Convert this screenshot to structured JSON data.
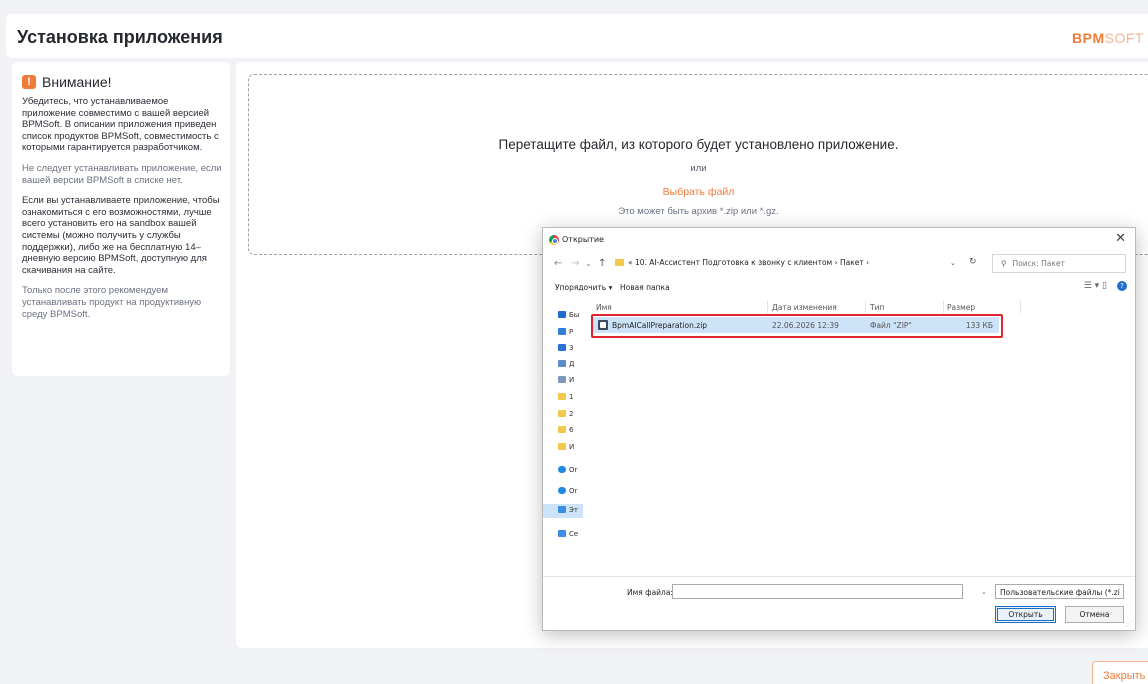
{
  "header": {
    "title": "Установка приложения",
    "logo_a": "BPM",
    "logo_b": "SOFT",
    "logo_accent": "#f07c3a"
  },
  "notice": {
    "icon": "warning-icon",
    "title": "Внимание!",
    "p1": "Убедитесь, что устанавливаемое приложение совместимо с вашей версией BPMSoft. В описании приложения приведен список продуктов BPMSoft, совместимость с которыми гарантируется разработчиком.",
    "p2": "Не следует устанавливать приложение, если вашей версии BPMSoft в списке нет.",
    "p3": "Если вы устанавливаете приложение, чтобы ознакомиться с его возможностями, лучше всего установить его на sandbox вашей системы (можно получить у службы поддержки), либо же на бесплатную 14–дневную версию BPMSoft, доступную для скачивания на сайте.",
    "p4": "Только после этого рекомендуем устанавливать продукт на продуктивную среду BPMSoft."
  },
  "dropzone": {
    "text": "Перетащите файл, из которого будет установлено приложение.",
    "or": "или",
    "choose": "Выбрать файл",
    "hint": "Это может быть архив *.zip или *.gz."
  },
  "close_label": "Закрыть",
  "dialog": {
    "title": "Открытие",
    "close_glyph": "✕",
    "back": "←",
    "forward": "→",
    "recent": "⌄",
    "up": "↑",
    "address": "« 10. AI-Ассистент Подготовка к звонку с клиентом › Пакет ›",
    "address_chevron": "⌄",
    "refresh": "↻",
    "search_icon": "⚲",
    "search_placeholder": "Поиск: Пакет",
    "organize": "Упорядочить ▾",
    "new_folder": "Новая папка",
    "view_icons": "☰ ▾ ▯",
    "help": "?",
    "nav": [
      {
        "label": "Бы",
        "color": "#1f6fd1"
      },
      {
        "label": "Р",
        "color": "#2f7fd8"
      },
      {
        "label": "З",
        "color": "#2a72d4"
      },
      {
        "label": "Д",
        "color": "#5c8ccf"
      },
      {
        "label": "И",
        "color": "#7c98bd"
      },
      {
        "label": "1",
        "color": "#f2c94c"
      },
      {
        "label": "2",
        "color": "#f2c94c"
      },
      {
        "label": "6",
        "color": "#f2c94c"
      },
      {
        "label": "И",
        "color": "#f2c94c"
      },
      {
        "label": "Or",
        "color": "#1e88e5"
      },
      {
        "label": "Or",
        "color": "#1e88e5"
      },
      {
        "label": "Эт",
        "color": "#3a8ee6"
      },
      {
        "label": "Се",
        "color": "#3a8ee6"
      }
    ],
    "columns": {
      "name": "Имя",
      "date": "Дата изменения",
      "type": "Тип",
      "size": "Размер"
    },
    "file": {
      "name": "BpmAICallPreparation.zip",
      "date": "22.06.2026 12:39",
      "type": "Файл \"ZIP\"",
      "size": "133 КБ"
    },
    "filename_label": "Имя файла:",
    "filename_chevron": "⌄",
    "filter": "Пользовательские файлы (*.zi ⌄",
    "open": "Открыть",
    "cancel": "Отмена"
  }
}
